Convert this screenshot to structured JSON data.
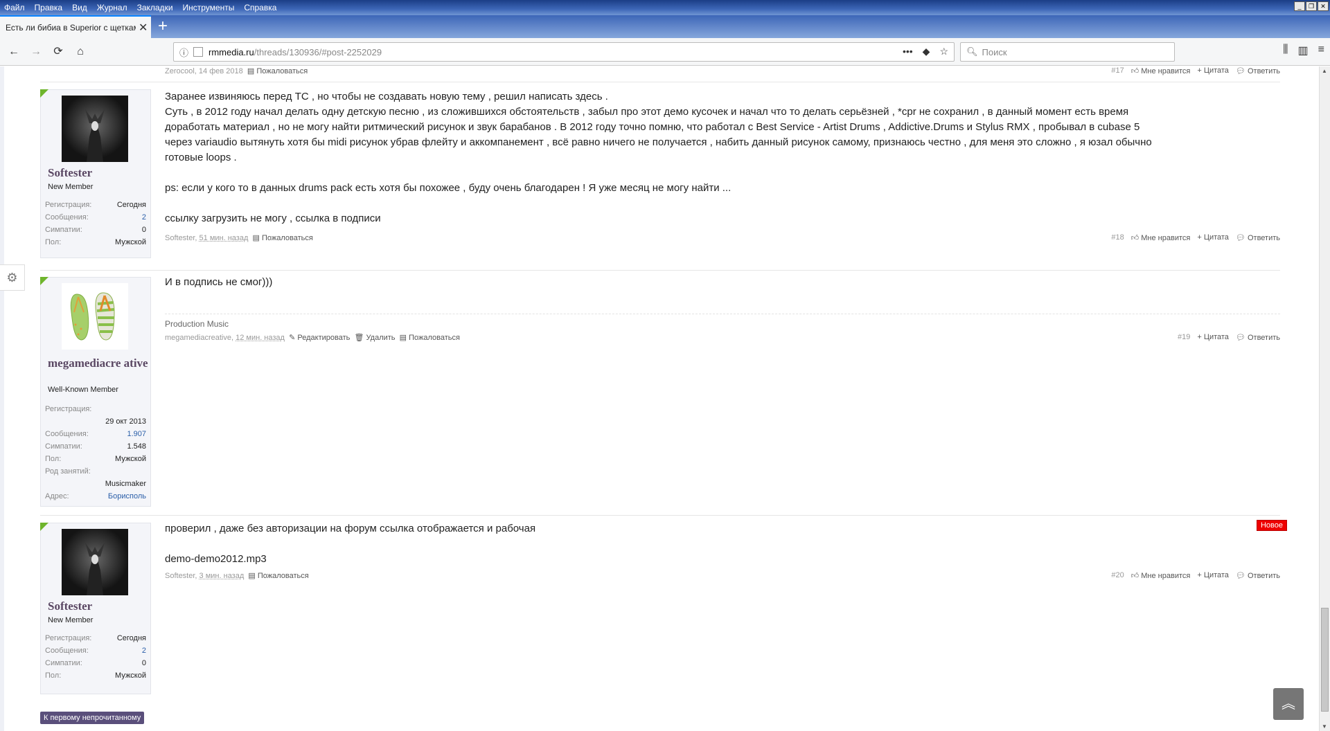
{
  "menubar": {
    "items": [
      "Файл",
      "Правка",
      "Вид",
      "Журнал",
      "Закладки",
      "Инструменты",
      "Справка"
    ]
  },
  "tab": {
    "title": "Есть ли бибиа в Superior с щетками т",
    "close": "✕"
  },
  "newtab": "+",
  "nav": {
    "back": "←",
    "forward": "→",
    "reload": "⟳",
    "home": "⌂",
    "url_host": "rmmedia.ru",
    "url_path": "/threads/130936/#post-2252029",
    "more": "•••",
    "pocket": "◆",
    "star": "☆",
    "search_placeholder": "Поиск",
    "library": "⫼",
    "sidebar": "▥",
    "menu": "≡"
  },
  "post17_meta": {
    "author": "Zerocool",
    "date": "14 фев 2018",
    "report": "Пожаловаться",
    "number": "#17",
    "like": "Мне нравится",
    "quote": "+ Цитата",
    "reply": "Ответить"
  },
  "post18": {
    "user": {
      "name": "Softester",
      "title": "New Member",
      "stats": [
        {
          "k": "Регистрация:",
          "v": "Сегодня"
        },
        {
          "k": "Сообщения:",
          "v": "2"
        },
        {
          "k": "Симпатии:",
          "v": "0"
        },
        {
          "k": "Пол:",
          "v": "Мужской"
        }
      ]
    },
    "lines": [
      "Заранее извиняюсь перед ТС , но чтобы не создавать новую тему , решил написать здесь .",
      "Суть , в 2012 году начал делать одну детскую песню , из сложившихся обстоятельств , забыл про этот демо кусочек и начал что то делать серьёзней , *cpr не сохранил , в данный момент есть время",
      "доработать материал , но не могу найти ритмический рисунок и звук барабанов . В 2012 году точно помню, что работал с Best Service - Artist Drums , Addictive.Drums и Stylus RMX , пробывал в cubase 5",
      "через variaudio вытянуть хотя бы midi рисунок убрав флейту и аккомпанемент , всё равно ничего не получается , набить данный рисунок самому, признаюсь честно , для меня это сложно , я юзал обычно",
      "готовые loops .",
      "",
      "ps: если у кого то в данных drums pack есть хотя бы похожее , буду очень благодарен ! Я уже месяц не могу найти ...",
      "",
      "ссылку загрузить не могу , ссылка в подписи"
    ],
    "footer": {
      "author": "Softester",
      "ago": "51 мин. назад",
      "report": "Пожаловаться",
      "number": "#18",
      "like": "Мне нравится",
      "quote": "+ Цитата",
      "reply": "Ответить"
    }
  },
  "post19": {
    "user": {
      "name": "megamediacre ative",
      "title": "Well-Known Member",
      "reg_label": "Регистрация:",
      "reg_value": "29 окт 2013",
      "stats": [
        {
          "k": "Сообщения:",
          "v": "1.907"
        },
        {
          "k": "Симпатии:",
          "v": "1.548"
        },
        {
          "k": "Пол:",
          "v": "Мужской"
        }
      ],
      "occ_label": "Род занятий:",
      "occ_value": "Musicmaker",
      "addr_label": "Адрес:",
      "addr_value": "Борисполь"
    },
    "text": "И в подпись не смог)))",
    "signature": "Production Music",
    "footer": {
      "author": "megamediacreative",
      "ago": "12 мин. назад",
      "edit": "Редактировать",
      "delete": "Удалить",
      "report": "Пожаловаться",
      "number": "#19",
      "quote": "+ Цитата",
      "reply": "Ответить"
    }
  },
  "post20": {
    "user": {
      "name": "Softester",
      "title": "New Member",
      "stats": [
        {
          "k": "Регистрация:",
          "v": "Сегодня"
        },
        {
          "k": "Сообщения:",
          "v": "2"
        },
        {
          "k": "Симпатии:",
          "v": "0"
        },
        {
          "k": "Пол:",
          "v": "Мужской"
        }
      ]
    },
    "badge": "Новое",
    "lines": [
      "проверил , даже без авторизации на форум ссылка отображается и рабочая",
      "",
      "demo-demo2012.mp3"
    ],
    "footer": {
      "author": "Softester",
      "ago": "3 мин. назад",
      "report": "Пожаловаться",
      "number": "#20",
      "like": "Мне нравится",
      "quote": "+ Цитата",
      "reply": "Ответить"
    }
  },
  "first_unread": "К первому непрочитанному",
  "to_top": "︽",
  "settings_icon": "⚙",
  "colors": {
    "accent": "#5a4763",
    "new_badge": "#ee0000",
    "corner": "#6fb52d"
  }
}
